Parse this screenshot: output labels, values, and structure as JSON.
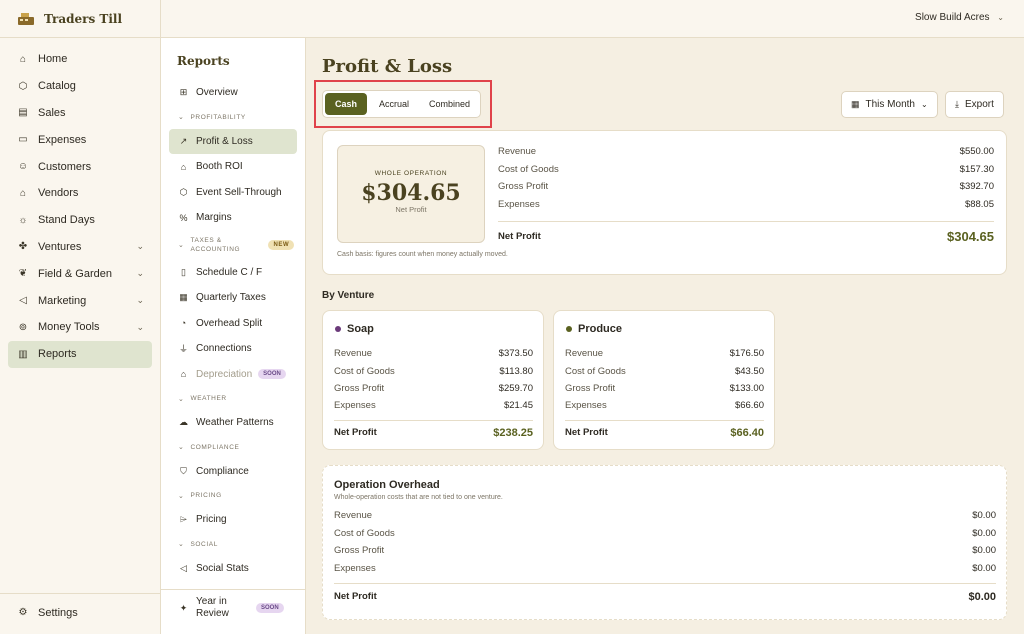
{
  "brand": {
    "name": "Traders Till"
  },
  "topbar": {
    "farm_name": "Slow Build Acres"
  },
  "sidebar": {
    "items": [
      {
        "label": "Home",
        "icon": "home-icon"
      },
      {
        "label": "Catalog",
        "icon": "box-icon"
      },
      {
        "label": "Sales",
        "icon": "receipt-icon"
      },
      {
        "label": "Expenses",
        "icon": "wallet-icon"
      },
      {
        "label": "Customers",
        "icon": "user-icon"
      },
      {
        "label": "Vendors",
        "icon": "store-icon"
      },
      {
        "label": "Stand Days",
        "icon": "sun-icon"
      },
      {
        "label": "Ventures",
        "icon": "ventures-icon"
      },
      {
        "label": "Field & Garden",
        "icon": "leaf-icon"
      },
      {
        "label": "Marketing",
        "icon": "megaphone-icon"
      },
      {
        "label": "Money Tools",
        "icon": "coins-icon"
      },
      {
        "label": "Reports",
        "icon": "bar-chart-icon"
      }
    ],
    "settings_label": "Settings"
  },
  "subnav": {
    "title": "Reports",
    "overview": "Overview",
    "sections": {
      "profitability": "PROFITABILITY",
      "taxes": "TAXES & ACCOUNTING",
      "weather": "WEATHER",
      "compliance": "COMPLIANCE",
      "pricing": "PRICING",
      "social": "SOCIAL"
    },
    "items": {
      "pl": "Profit & Loss",
      "booth": "Booth ROI",
      "event": "Event Sell-Through",
      "margins": "Margins",
      "schedule": "Schedule C / F",
      "quarterly": "Quarterly Taxes",
      "overhead": "Overhead Split",
      "connections": "Connections",
      "depreciation": "Depreciation",
      "weather": "Weather Patterns",
      "compliance": "Compliance",
      "pricing": "Pricing",
      "social": "Social Stats",
      "year": "Year in Review"
    },
    "badges": {
      "new": "NEW",
      "soon": "SOON"
    }
  },
  "main": {
    "title": "Profit & Loss",
    "basis_tabs": [
      "Cash",
      "Accrual",
      "Combined"
    ],
    "period": "This Month",
    "export": "Export",
    "summary": {
      "label": "WHOLE OPERATION",
      "value": "$304.65",
      "sub": "Net Profit",
      "rows": [
        {
          "label": "Revenue",
          "value": "$550.00"
        },
        {
          "label": "Cost of Goods",
          "value": "$157.30"
        },
        {
          "label": "Gross Profit",
          "value": "$392.70"
        },
        {
          "label": "Expenses",
          "value": "$88.05"
        }
      ],
      "total": {
        "label": "Net Profit",
        "value": "$304.65"
      },
      "note": "Cash basis: figures count when money actually moved."
    },
    "by_venture_label": "By Venture",
    "ventures": [
      {
        "name": "Soap",
        "color": "#6b3a7a",
        "rows": [
          {
            "label": "Revenue",
            "value": "$373.50"
          },
          {
            "label": "Cost of Goods",
            "value": "$113.80"
          },
          {
            "label": "Gross Profit",
            "value": "$259.70"
          },
          {
            "label": "Expenses",
            "value": "$21.45"
          }
        ],
        "total": {
          "label": "Net Profit",
          "value": "$238.25"
        }
      },
      {
        "name": "Produce",
        "color": "#5a6120",
        "rows": [
          {
            "label": "Revenue",
            "value": "$176.50"
          },
          {
            "label": "Cost of Goods",
            "value": "$43.50"
          },
          {
            "label": "Gross Profit",
            "value": "$133.00"
          },
          {
            "label": "Expenses",
            "value": "$66.60"
          }
        ],
        "total": {
          "label": "Net Profit",
          "value": "$66.40"
        }
      }
    ],
    "overhead": {
      "title": "Operation Overhead",
      "sub": "Whole-operation costs that are not tied to one venture.",
      "rows": [
        {
          "label": "Revenue",
          "value": "$0.00"
        },
        {
          "label": "Cost of Goods",
          "value": "$0.00"
        },
        {
          "label": "Gross Profit",
          "value": "$0.00"
        },
        {
          "label": "Expenses",
          "value": "$0.00"
        }
      ],
      "total": {
        "label": "Net Profit",
        "value": "$0.00"
      }
    }
  }
}
